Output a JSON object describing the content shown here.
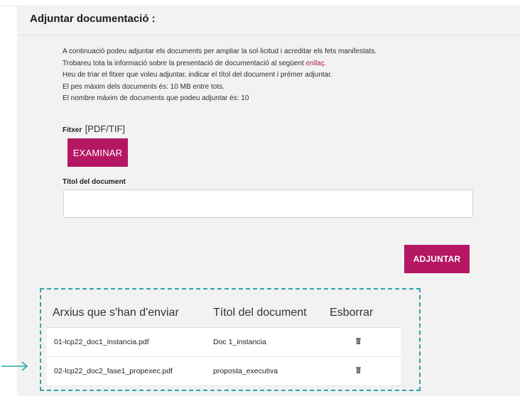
{
  "section": {
    "title": "Adjuntar documentació :"
  },
  "info": {
    "line1": "A continuació podeu adjuntar els documents per ampliar la sol·licitud i acreditar els fets manifestats.",
    "line2_prefix": "Trobareu tota la informació sobre la presentació de documentació al següent ",
    "line2_link": "enllaç.",
    "line3": "Heu de triar el fitxer que voleu adjuntar, indicar el títol del document i prémer adjuntar.",
    "line4": "El pes màxim dels documents és: 10 MB entre tots.",
    "line5": "El nombre màxim de documents que podeu adjuntar és: 10"
  },
  "file": {
    "label": "Fitxer",
    "types": "[PDF/TIF]",
    "browse_button": "EXAMINAR"
  },
  "doc_title": {
    "label": "Títol del document",
    "value": ""
  },
  "attach_button": "ADJUNTAR",
  "table": {
    "headers": [
      "Arxius que s'han d'enviar",
      "Títol del document",
      "Esborrar"
    ],
    "rows": [
      {
        "file": "01-lcp22_doc1_instancia.pdf",
        "title": "Doc 1_instancia",
        "delete_icon": "trash-icon"
      },
      {
        "file": "02-lcp22_doc2_fase1_propexec.pdf",
        "title": "proposta_executiva",
        "delete_icon": "trash-icon"
      }
    ]
  },
  "colors": {
    "accent": "#b51762",
    "highlight": "#2aa5a5"
  }
}
